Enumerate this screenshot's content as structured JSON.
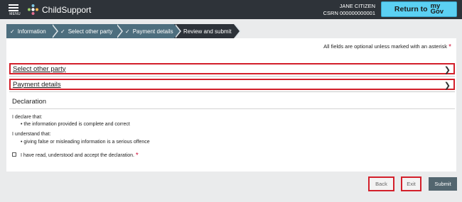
{
  "header": {
    "menu_label": "MENU",
    "app_name": "ChildSupport",
    "user_name": "JANE CITIZEN",
    "csrn": "CSRN 000000000001",
    "return_label": "Return to",
    "mygov_line1": "my",
    "mygov_line2": "Gov"
  },
  "progress": {
    "steps": [
      {
        "label": "Information",
        "status": "complete"
      },
      {
        "label": "Select other party",
        "status": "complete"
      },
      {
        "label": "Payment details",
        "status": "complete"
      },
      {
        "label": "Review and submit",
        "status": "current"
      }
    ]
  },
  "form": {
    "required_hint": "All fields are optional unless marked with an asterisk",
    "required_marker": "*",
    "accordions": [
      {
        "label": "Select other party"
      },
      {
        "label": "Payment details"
      }
    ],
    "declaration": {
      "title": "Declaration",
      "declare_intro": "I declare that:",
      "declare_items": [
        "the information provided is complete and correct"
      ],
      "understand_intro": "I understand that:",
      "understand_items": [
        "giving false or misleading information is a serious offence"
      ],
      "accept_label": "I have read, understood and accept the declaration.",
      "accept_checked": false
    }
  },
  "footer": {
    "back_label": "Back",
    "exit_label": "Exit",
    "submit_label": "Submit"
  },
  "colors": {
    "header_bg": "#2e3339",
    "mygov_bg": "#5bd0f3",
    "step_complete": "#4d6e7e",
    "step_current": "#2d3239",
    "highlight_border": "#d31f2a",
    "asterisk": "#d0103a",
    "submit_bg": "#53666f"
  }
}
